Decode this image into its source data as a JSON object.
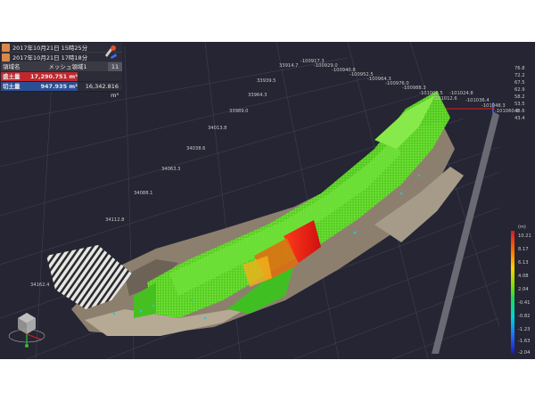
{
  "panel": {
    "timestamp_1": "2017年10月21日 15時25分",
    "timestamp_2": "2017年10月21日 17時18分",
    "col_region": "領域名",
    "col_mesh": "メッシュ領域1",
    "col_extra": "11",
    "fill_label": "盛土量",
    "fill_value": "17,290.751 m³",
    "cut_label": "切土量",
    "cut_value": "947.935 m³",
    "cut_total": "16,342.816 m³"
  },
  "axes": {
    "y_labels": [
      "33914.7",
      "33939.5",
      "33964.3",
      "33989.0",
      "34013.8",
      "34038.6",
      "34063.3",
      "34088.1",
      "34112.8",
      "34162.4"
    ],
    "x_labels": [
      "-100917.3",
      "-100929.0",
      "-100940.8",
      "-100952.5",
      "-100964.3",
      "-100976.0",
      "-100988.3",
      "-101000.5",
      "-101012.6",
      "-101024.8",
      "-101036.4",
      "-101048.3",
      "-101060.5"
    ],
    "z_labels": [
      "76.8",
      "72.2",
      "67.5",
      "62.9",
      "58.2",
      "53.5",
      "48.6",
      "43.4"
    ]
  },
  "legend": {
    "unit": "(m)",
    "ticks": [
      "10.21",
      "8.17",
      "6.13",
      "4.08",
      "2.04",
      "-0.41",
      "-0.82",
      "-1.23",
      "-1.63",
      "-2.04"
    ]
  },
  "colors": {
    "background": "#252533",
    "fill_red": "#c1272d",
    "cut_blue": "#2b4f93",
    "cloud_green": "#5ee02a"
  },
  "icons": {
    "timestamp": "calendar-icon",
    "tool": "measure-tool-icon",
    "orientation": "orientation-cube-icon"
  }
}
